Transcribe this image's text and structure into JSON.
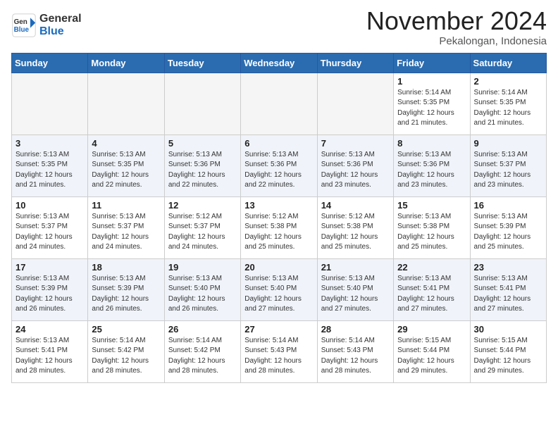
{
  "header": {
    "logo_general": "General",
    "logo_blue": "Blue",
    "month_title": "November 2024",
    "location": "Pekalongan, Indonesia"
  },
  "weekdays": [
    "Sunday",
    "Monday",
    "Tuesday",
    "Wednesday",
    "Thursday",
    "Friday",
    "Saturday"
  ],
  "rows": [
    [
      {
        "day": "",
        "sunrise": "",
        "sunset": "",
        "daylight": "",
        "empty": true
      },
      {
        "day": "",
        "sunrise": "",
        "sunset": "",
        "daylight": "",
        "empty": true
      },
      {
        "day": "",
        "sunrise": "",
        "sunset": "",
        "daylight": "",
        "empty": true
      },
      {
        "day": "",
        "sunrise": "",
        "sunset": "",
        "daylight": "",
        "empty": true
      },
      {
        "day": "",
        "sunrise": "",
        "sunset": "",
        "daylight": "",
        "empty": true
      },
      {
        "day": "1",
        "sunrise": "Sunrise: 5:14 AM",
        "sunset": "Sunset: 5:35 PM",
        "daylight": "Daylight: 12 hours and 21 minutes.",
        "empty": false
      },
      {
        "day": "2",
        "sunrise": "Sunrise: 5:14 AM",
        "sunset": "Sunset: 5:35 PM",
        "daylight": "Daylight: 12 hours and 21 minutes.",
        "empty": false
      }
    ],
    [
      {
        "day": "3",
        "sunrise": "Sunrise: 5:13 AM",
        "sunset": "Sunset: 5:35 PM",
        "daylight": "Daylight: 12 hours and 21 minutes.",
        "empty": false
      },
      {
        "day": "4",
        "sunrise": "Sunrise: 5:13 AM",
        "sunset": "Sunset: 5:35 PM",
        "daylight": "Daylight: 12 hours and 22 minutes.",
        "empty": false
      },
      {
        "day": "5",
        "sunrise": "Sunrise: 5:13 AM",
        "sunset": "Sunset: 5:36 PM",
        "daylight": "Daylight: 12 hours and 22 minutes.",
        "empty": false
      },
      {
        "day": "6",
        "sunrise": "Sunrise: 5:13 AM",
        "sunset": "Sunset: 5:36 PM",
        "daylight": "Daylight: 12 hours and 22 minutes.",
        "empty": false
      },
      {
        "day": "7",
        "sunrise": "Sunrise: 5:13 AM",
        "sunset": "Sunset: 5:36 PM",
        "daylight": "Daylight: 12 hours and 23 minutes.",
        "empty": false
      },
      {
        "day": "8",
        "sunrise": "Sunrise: 5:13 AM",
        "sunset": "Sunset: 5:36 PM",
        "daylight": "Daylight: 12 hours and 23 minutes.",
        "empty": false
      },
      {
        "day": "9",
        "sunrise": "Sunrise: 5:13 AM",
        "sunset": "Sunset: 5:37 PM",
        "daylight": "Daylight: 12 hours and 23 minutes.",
        "empty": false
      }
    ],
    [
      {
        "day": "10",
        "sunrise": "Sunrise: 5:13 AM",
        "sunset": "Sunset: 5:37 PM",
        "daylight": "Daylight: 12 hours and 24 minutes.",
        "empty": false
      },
      {
        "day": "11",
        "sunrise": "Sunrise: 5:13 AM",
        "sunset": "Sunset: 5:37 PM",
        "daylight": "Daylight: 12 hours and 24 minutes.",
        "empty": false
      },
      {
        "day": "12",
        "sunrise": "Sunrise: 5:12 AM",
        "sunset": "Sunset: 5:37 PM",
        "daylight": "Daylight: 12 hours and 24 minutes.",
        "empty": false
      },
      {
        "day": "13",
        "sunrise": "Sunrise: 5:12 AM",
        "sunset": "Sunset: 5:38 PM",
        "daylight": "Daylight: 12 hours and 25 minutes.",
        "empty": false
      },
      {
        "day": "14",
        "sunrise": "Sunrise: 5:12 AM",
        "sunset": "Sunset: 5:38 PM",
        "daylight": "Daylight: 12 hours and 25 minutes.",
        "empty": false
      },
      {
        "day": "15",
        "sunrise": "Sunrise: 5:13 AM",
        "sunset": "Sunset: 5:38 PM",
        "daylight": "Daylight: 12 hours and 25 minutes.",
        "empty": false
      },
      {
        "day": "16",
        "sunrise": "Sunrise: 5:13 AM",
        "sunset": "Sunset: 5:39 PM",
        "daylight": "Daylight: 12 hours and 25 minutes.",
        "empty": false
      }
    ],
    [
      {
        "day": "17",
        "sunrise": "Sunrise: 5:13 AM",
        "sunset": "Sunset: 5:39 PM",
        "daylight": "Daylight: 12 hours and 26 minutes.",
        "empty": false
      },
      {
        "day": "18",
        "sunrise": "Sunrise: 5:13 AM",
        "sunset": "Sunset: 5:39 PM",
        "daylight": "Daylight: 12 hours and 26 minutes.",
        "empty": false
      },
      {
        "day": "19",
        "sunrise": "Sunrise: 5:13 AM",
        "sunset": "Sunset: 5:40 PM",
        "daylight": "Daylight: 12 hours and 26 minutes.",
        "empty": false
      },
      {
        "day": "20",
        "sunrise": "Sunrise: 5:13 AM",
        "sunset": "Sunset: 5:40 PM",
        "daylight": "Daylight: 12 hours and 27 minutes.",
        "empty": false
      },
      {
        "day": "21",
        "sunrise": "Sunrise: 5:13 AM",
        "sunset": "Sunset: 5:40 PM",
        "daylight": "Daylight: 12 hours and 27 minutes.",
        "empty": false
      },
      {
        "day": "22",
        "sunrise": "Sunrise: 5:13 AM",
        "sunset": "Sunset: 5:41 PM",
        "daylight": "Daylight: 12 hours and 27 minutes.",
        "empty": false
      },
      {
        "day": "23",
        "sunrise": "Sunrise: 5:13 AM",
        "sunset": "Sunset: 5:41 PM",
        "daylight": "Daylight: 12 hours and 27 minutes.",
        "empty": false
      }
    ],
    [
      {
        "day": "24",
        "sunrise": "Sunrise: 5:13 AM",
        "sunset": "Sunset: 5:41 PM",
        "daylight": "Daylight: 12 hours and 28 minutes.",
        "empty": false
      },
      {
        "day": "25",
        "sunrise": "Sunrise: 5:14 AM",
        "sunset": "Sunset: 5:42 PM",
        "daylight": "Daylight: 12 hours and 28 minutes.",
        "empty": false
      },
      {
        "day": "26",
        "sunrise": "Sunrise: 5:14 AM",
        "sunset": "Sunset: 5:42 PM",
        "daylight": "Daylight: 12 hours and 28 minutes.",
        "empty": false
      },
      {
        "day": "27",
        "sunrise": "Sunrise: 5:14 AM",
        "sunset": "Sunset: 5:43 PM",
        "daylight": "Daylight: 12 hours and 28 minutes.",
        "empty": false
      },
      {
        "day": "28",
        "sunrise": "Sunrise: 5:14 AM",
        "sunset": "Sunset: 5:43 PM",
        "daylight": "Daylight: 12 hours and 28 minutes.",
        "empty": false
      },
      {
        "day": "29",
        "sunrise": "Sunrise: 5:15 AM",
        "sunset": "Sunset: 5:44 PM",
        "daylight": "Daylight: 12 hours and 29 minutes.",
        "empty": false
      },
      {
        "day": "30",
        "sunrise": "Sunrise: 5:15 AM",
        "sunset": "Sunset: 5:44 PM",
        "daylight": "Daylight: 12 hours and 29 minutes.",
        "empty": false
      }
    ]
  ]
}
